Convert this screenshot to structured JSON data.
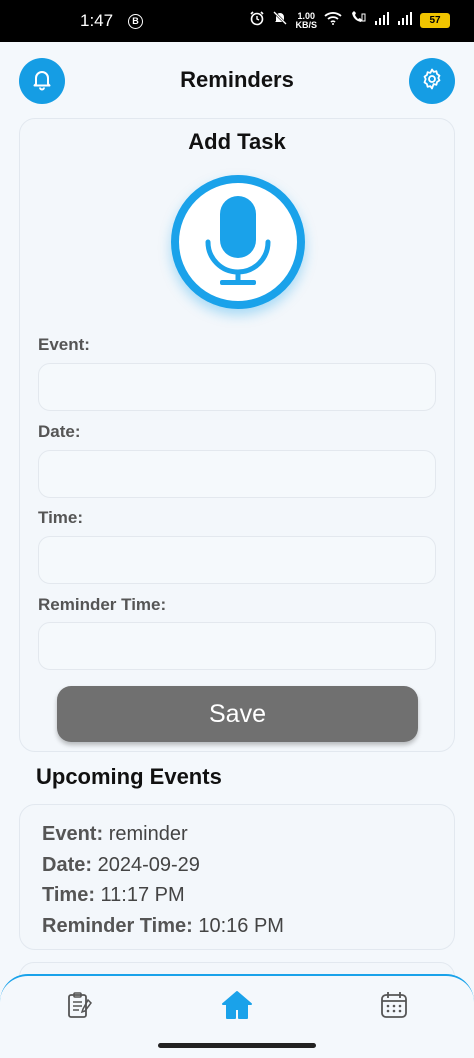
{
  "status_bar": {
    "time": "1:47",
    "b_badge": "B",
    "net_speed_value": "1.00",
    "net_speed_unit": "KB/S",
    "battery": "57"
  },
  "header": {
    "title": "Reminders",
    "accent_color": "#159de4"
  },
  "add_task": {
    "title": "Add Task",
    "fields": {
      "event": {
        "label": "Event:",
        "value": ""
      },
      "date": {
        "label": "Date:",
        "value": ""
      },
      "time": {
        "label": "Time:",
        "value": ""
      },
      "reminder_time": {
        "label": "Reminder Time:",
        "value": ""
      }
    },
    "save_label": "Save"
  },
  "upcoming": {
    "title": "Upcoming Events",
    "events": [
      {
        "event_key": "Event:",
        "event_value": "reminder",
        "date_key": "Date:",
        "date_value": "2024-09-29",
        "time_key": "Time:",
        "time_value": "11:17 PM",
        "reminder_key": "Reminder Time:",
        "reminder_value": "10:16 PM"
      }
    ]
  },
  "bottom_nav": {
    "items": [
      {
        "icon": "clipboard-icon"
      },
      {
        "icon": "home-icon",
        "active": true
      },
      {
        "icon": "calendar-icon"
      }
    ]
  }
}
